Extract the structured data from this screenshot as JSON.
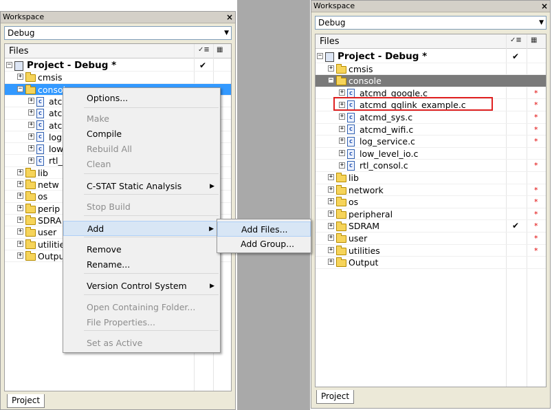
{
  "left": {
    "title": "Workspace",
    "close": "×",
    "config": "Debug",
    "files_header": "Files",
    "project": "Project - Debug *",
    "items": [
      {
        "label": "cmsis"
      },
      {
        "label": "console"
      },
      {
        "label": "atcmd_google.c"
      },
      {
        "label": "atcmd_qqlink_example.c"
      },
      {
        "label": "atcmd_sys.c"
      },
      {
        "label": "log_service.c"
      },
      {
        "label": "low_level_io.c"
      },
      {
        "label": "rtl_consol.c"
      },
      {
        "label": "lib"
      },
      {
        "label": "network"
      },
      {
        "label": "os"
      },
      {
        "label": "peripheral"
      },
      {
        "label": "SDRAM"
      },
      {
        "label": "user"
      },
      {
        "label": "utilities"
      },
      {
        "label": "Output"
      }
    ],
    "visible_labels": [
      "cmsis",
      "console",
      "atc",
      "atc",
      "atc",
      "log",
      "low",
      "rtl_",
      "lib",
      "netw",
      "os",
      "perip",
      "SDRA",
      "user",
      "utilitie",
      "Outpu"
    ],
    "tab": "Project"
  },
  "context_menu": {
    "items": [
      {
        "label": "Options...",
        "disabled": false
      },
      {
        "label": "Make",
        "disabled": true
      },
      {
        "label": "Compile",
        "disabled": false
      },
      {
        "label": "Rebuild All",
        "disabled": true
      },
      {
        "label": "Clean",
        "disabled": true
      },
      {
        "label": "C-STAT Static Analysis",
        "disabled": false
      },
      {
        "label": "Stop Build",
        "disabled": true
      },
      {
        "label": "Add",
        "disabled": false
      },
      {
        "label": "Remove",
        "disabled": false
      },
      {
        "label": "Rename...",
        "disabled": false
      },
      {
        "label": "Version Control System",
        "disabled": false
      },
      {
        "label": "Open Containing Folder...",
        "disabled": true
      },
      {
        "label": "File Properties...",
        "disabled": true
      },
      {
        "label": "Set as Active",
        "disabled": true
      }
    ],
    "submenu": [
      {
        "label": "Add Files..."
      },
      {
        "label": "Add Group..."
      }
    ]
  },
  "right": {
    "title": "Workspace",
    "close": "×",
    "config": "Debug",
    "files_header": "Files",
    "project": "Project - Debug *",
    "items": [
      {
        "label": "cmsis"
      },
      {
        "label": "console"
      },
      {
        "label": "atcmd_google.c"
      },
      {
        "label": "atcmd_qqlink_example.c"
      },
      {
        "label": "atcmd_sys.c"
      },
      {
        "label": "atcmd_wifi.c"
      },
      {
        "label": "log_service.c"
      },
      {
        "label": "low_level_io.c"
      },
      {
        "label": "rtl_consol.c"
      },
      {
        "label": "lib"
      },
      {
        "label": "network"
      },
      {
        "label": "os"
      },
      {
        "label": "peripheral"
      },
      {
        "label": "SDRAM"
      },
      {
        "label": "user"
      },
      {
        "label": "utilities"
      },
      {
        "label": "Output"
      }
    ],
    "tab": "Project"
  },
  "symbols": {
    "check": "✔",
    "star": "*",
    "plus": "+",
    "minus": "−",
    "c": "c",
    "arrow_right": "▶",
    "arrow_down": "▼"
  },
  "colors": {
    "selection_gray": "#7a7a7a",
    "selection_blue": "#3399ff",
    "highlight_box": "#e02020",
    "modified_star": "#e00000"
  }
}
